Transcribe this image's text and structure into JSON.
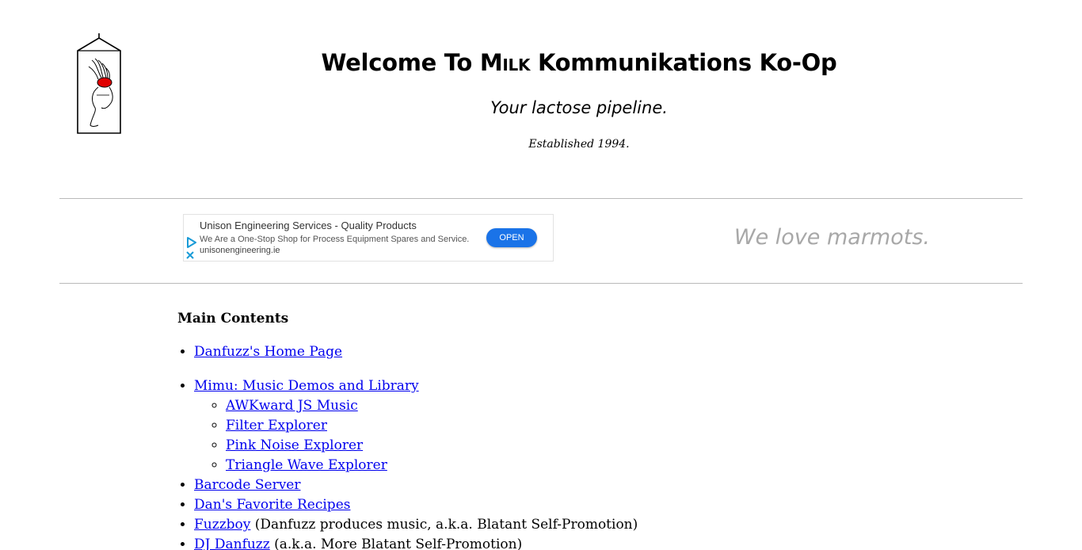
{
  "header": {
    "title_prefix": "Welcome To ",
    "title_milk": "Milk",
    "title_suffix": " Kommunikations Ko-Op",
    "tagline": "Your lactose pipeline.",
    "established": "Established 1994."
  },
  "ad": {
    "title": "Unison Engineering Services - Quality Products",
    "description": "We Are a One-Stop Shop for Process Equipment Spares and Service.",
    "url": "unisonengineering.ie",
    "open_label": "OPEN",
    "accent_color": "#1a73e8"
  },
  "slogan": "We love marmots.",
  "main": {
    "heading": "Main Contents",
    "items": [
      {
        "label": "Danfuzz's Home Page"
      },
      {
        "label": "Mimu: Music Demos and Library"
      },
      {
        "label": "AWKward JS Music"
      },
      {
        "label": "Filter Explorer"
      },
      {
        "label": "Pink Noise Explorer"
      },
      {
        "label": "Triangle Wave Explorer"
      },
      {
        "label": "Barcode Server"
      },
      {
        "label": "Dan's Favorite Recipes"
      },
      {
        "label": "Fuzzboy",
        "note": " (Danfuzz produces music, a.k.a. Blatant Self-Promotion)"
      },
      {
        "label": "DJ Danfuzz",
        "note": " (a.k.a. More Blatant Self-Promotion)"
      }
    ]
  },
  "colors": {
    "link": "#0000ee",
    "rule": "#b9b9b9",
    "slogan": "#a8a8a8"
  }
}
